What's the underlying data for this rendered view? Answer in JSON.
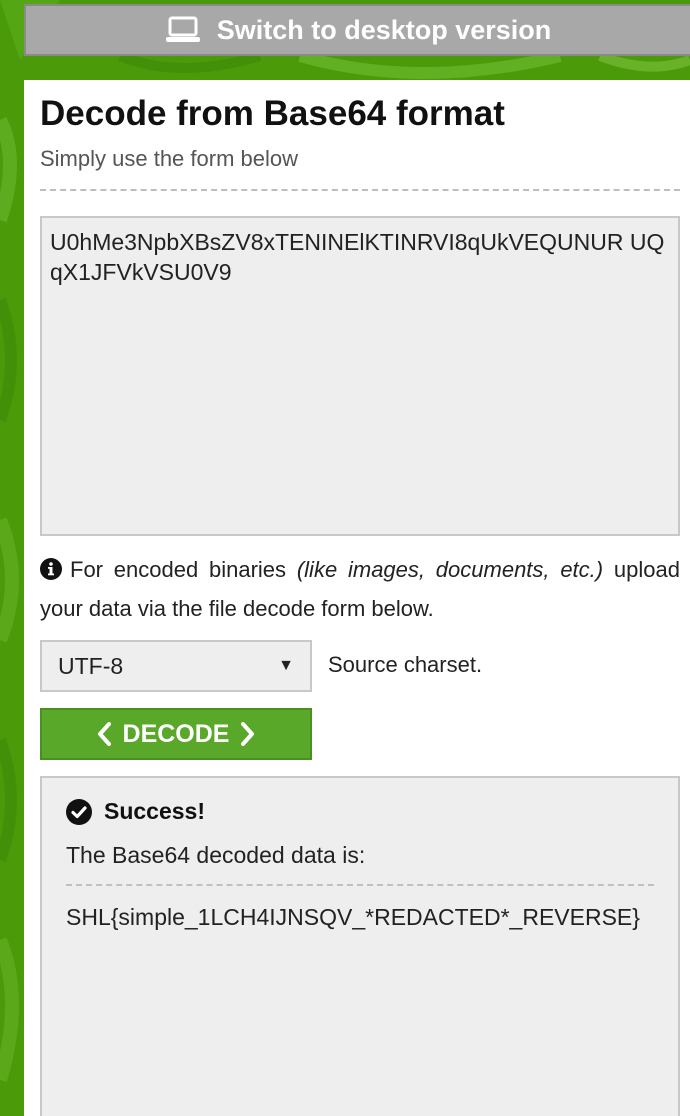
{
  "topbar": {
    "label": "Switch to desktop version",
    "icon": "laptop-icon"
  },
  "header": {
    "title": "Decode from Base64 format",
    "subtitle": "Simply use the form below"
  },
  "input": {
    "value": "U0hMe3NpbXBsZV8xTENINElKTINRVI8qUkVEQUNUR UQqX1JFVkVSU0V9"
  },
  "note": {
    "text_before": "For encoded binaries ",
    "text_italic": "(like images, documents, etc.)",
    "text_after": " upload your data via the file decode form below.",
    "icon": "info-icon"
  },
  "charset": {
    "selected": "UTF-8",
    "label": "Source charset."
  },
  "decode_button": {
    "label": "DECODE"
  },
  "result": {
    "status": "Success!",
    "label": "The Base64 decoded data is:",
    "value": "SHL{simple_1LCH4IJNSQV_*REDACTED*_REVERSE}"
  },
  "colors": {
    "background_green": "#4a9a0a",
    "button_green": "#5aa82a",
    "topbar_gray": "#a8a8a8"
  }
}
